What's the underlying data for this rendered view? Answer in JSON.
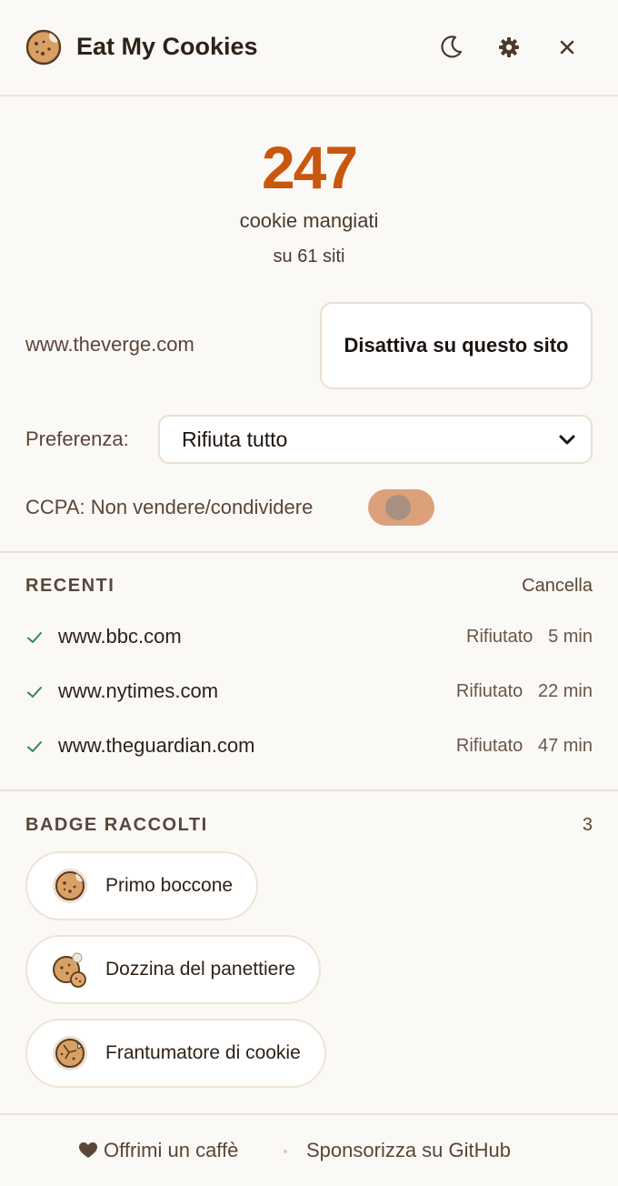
{
  "header": {
    "title": "Eat My Cookies",
    "icons": [
      "cookie-logo-icon",
      "moon-icon",
      "gear-icon",
      "close-icon"
    ]
  },
  "stats": {
    "count": "247",
    "label": "cookie mangiati",
    "sites": "su 61 siti"
  },
  "site": {
    "domain": "www.theverge.com",
    "disable_label": "Disattiva su questo sito",
    "preference_label": "Preferenza:",
    "preference_value": "Rifiuta tutto",
    "ccpa_label": "CCPA: Non vendere/condividere",
    "ccpa_enabled": false
  },
  "recent": {
    "title": "RECENTI",
    "clear_label": "Cancella",
    "items": [
      {
        "domain": "www.bbc.com",
        "status": "Rifiutato",
        "time": "5 min"
      },
      {
        "domain": "www.nytimes.com",
        "status": "Rifiutato",
        "time": "22 min"
      },
      {
        "domain": "www.theguardian.com",
        "status": "Rifiutato",
        "time": "47 min"
      }
    ]
  },
  "badges": {
    "title": "BADGE RACCOLTI",
    "count": "3",
    "items": [
      {
        "label": "Primo boccone",
        "icon": "cookie-icon"
      },
      {
        "label": "Dozzina del panettiere",
        "icon": "cookie-stack-icon"
      },
      {
        "label": "Frantumatore di cookie",
        "icon": "crushed-cookie-icon"
      }
    ]
  },
  "footer": {
    "coffee_label": "Offrimi un caffè",
    "github_label": "Sponsorizza su GitHub"
  },
  "colors": {
    "accent": "#c9570f",
    "background": "#fbf9f6",
    "toggle": "#dca17a",
    "check": "#2f8a4a"
  }
}
